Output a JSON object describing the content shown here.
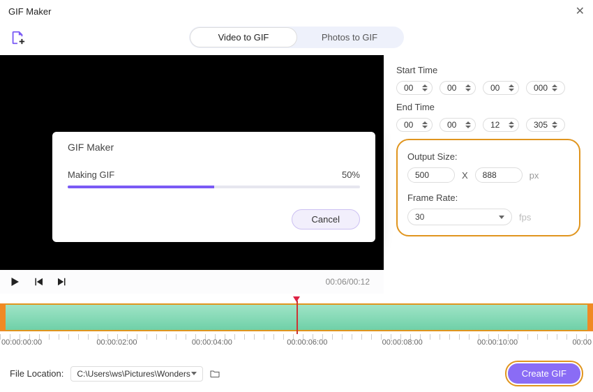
{
  "title": "GIF Maker",
  "tabs": {
    "video": "Video to GIF",
    "photos": "Photos to GIF"
  },
  "modal": {
    "title": "GIF Maker",
    "status": "Making GIF",
    "percent": "50%",
    "cancel": "Cancel"
  },
  "transport": {
    "time": "00:06/00:12"
  },
  "start": {
    "label": "Start Time",
    "h": "00",
    "m": "00",
    "s": "00",
    "ms": "000"
  },
  "end": {
    "label": "End Time",
    "h": "00",
    "m": "00",
    "s": "12",
    "ms": "305"
  },
  "output": {
    "size_label": "Output Size:",
    "w": "500",
    "h": "888",
    "x": "X",
    "px": "px",
    "rate_label": "Frame Rate:",
    "rate": "30",
    "fps": "fps"
  },
  "ruler": {
    "t0": "00:00:00:00",
    "t1": "00:00:02:00",
    "t2": "00:00:04:00",
    "t3": "00:00:06:00",
    "t4": "00:00:08:00",
    "t5": "00:00:10:00",
    "t6": "00:00"
  },
  "footer": {
    "label": "File Location:",
    "path": "C:\\Users\\ws\\Pictures\\Wonders",
    "create": "Create GIF"
  }
}
